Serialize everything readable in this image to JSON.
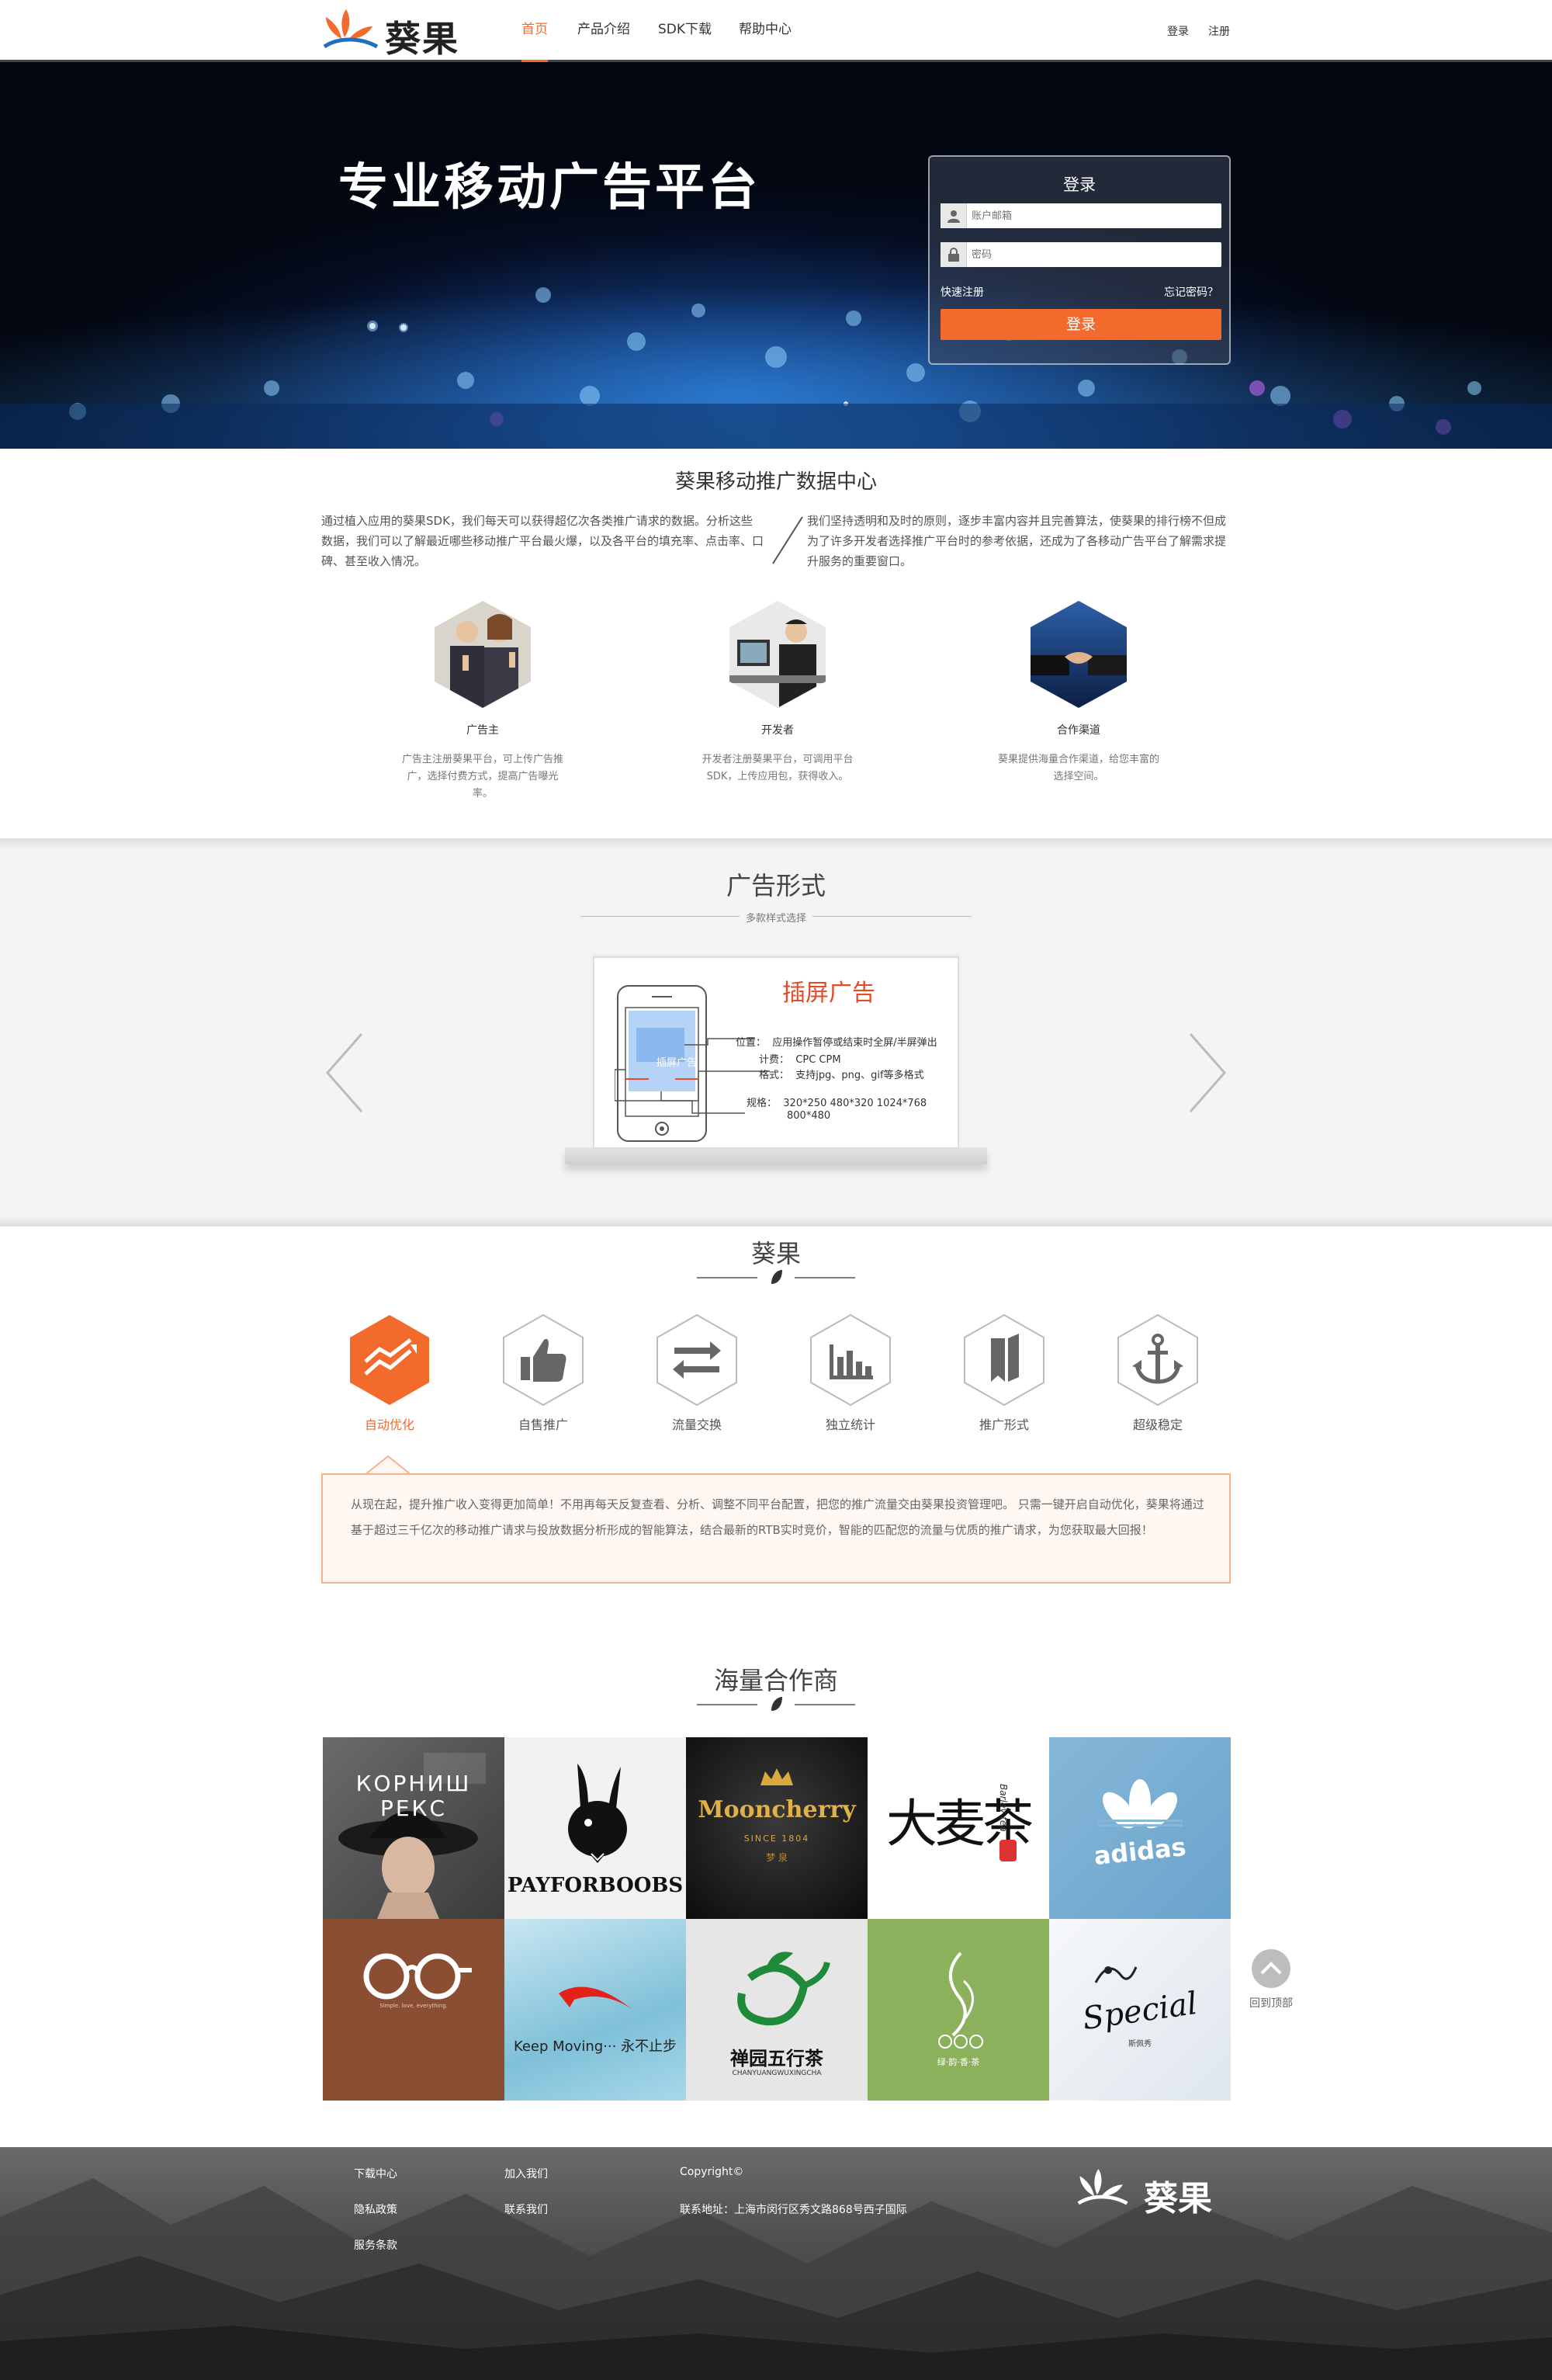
{
  "header": {
    "logo_text": "葵果",
    "nav": [
      "首页",
      "产品介绍",
      "SDK下载",
      "帮助中心"
    ],
    "login": "登录",
    "register": "注册"
  },
  "hero": {
    "title": "专业移动广告平台",
    "login_title": "登录",
    "email_placeholder": "账户邮箱",
    "password_placeholder": "密码",
    "quick_register": "快速注册",
    "forgot_password": "忘记密码？",
    "login_button": "登录"
  },
  "data_center": {
    "title": "葵果移动推广数据中心",
    "left_text": "通过植入应用的葵果SDK，我们每天可以获得超亿次各类推广请求的数据。分析这些数据，我们可以了解最近哪些移动推广平台最火爆，以及各平台的填充率、点击率、口碑、甚至收入情况。",
    "right_text": "我们坚持透明和及时的原则，逐步丰富内容并且完善算法，使葵果的排行榜不但成为了许多开发者选择推广平台时的参考依据，还成为了各移动广告平台了解需求提升服务的重要窗口。",
    "roles": [
      {
        "name": "广告主",
        "desc": "广告主注册葵果平台，可上传广告推广，选择付费方式，提高广告曝光率。"
      },
      {
        "name": "开发者",
        "desc": "开发者注册葵果平台，可调用平台SDK，上传应用包，获得收入。"
      },
      {
        "name": "合作渠道",
        "desc": "葵果提供海量合作渠道，给您丰富的选择空间。"
      }
    ]
  },
  "ad_format": {
    "title": "广告形式",
    "subtitle": "多款样式选择",
    "card_title": "插屏广告",
    "screen_label": "插屏广告",
    "position_label": "位置：",
    "position_value": "应用操作暂停或结束时全屏/半屏弹出",
    "billing_label": "计费：",
    "billing_value": "CPC  CPM",
    "format_label": "格式：",
    "format_value": "支持jpg、png、gif等多格式",
    "spec_label": "规格：",
    "spec_value": "320*250  480*320  1024*768",
    "spec_value2": "800*480"
  },
  "features": {
    "title": "葵果",
    "items": [
      "自动优化",
      "自售推广",
      "流量交换",
      "独立统计",
      "推广形式",
      "超级稳定"
    ],
    "text": "从现在起，提升推广收入变得更加简单！不用再每天反复查看、分析、调整不同平台配置，把您的推广流量交由葵果投资管理吧。 只需一键开启自动优化，葵果将通过基于超过三千亿次的移动推广请求与投放数据分析形成的智能算法，结合最新的RTB实时竞价，智能的匹配您的流量与优质的推广请求，为您获取最大回报！"
  },
  "partners": {
    "title": "海量合作商",
    "row1": [
      "КОРНИШ РЕКС",
      "PAYFORBOOBS",
      "Mooncherry",
      "大麦茶",
      "adidas"
    ],
    "moon_sub": "SINCE 1804",
    "moon_cn": "梦 泉",
    "bull_sub": "Barley tea",
    "row2": [
      "",
      "Keep Moving··· 永不止步",
      "禅园五行茶",
      "",
      "Special"
    ],
    "chanyuan_sub": "CHANYUANGWUXINGCHA",
    "special_sub": "斯佩秀",
    "leaf_sub": "绿·韵·香·茶",
    "glasses_sub": "Simple. love. everything."
  },
  "back_top": "回到顶部",
  "footer": {
    "col1": [
      "下载中心",
      "隐私政策",
      "服务条款"
    ],
    "col2": [
      "加入我们",
      "联系我们"
    ],
    "copyright": "Copyright©",
    "address": "联系地址：上海市闵行区秀文路868号西子国际",
    "logo_text": "葵果"
  },
  "colors": {
    "accent": "#f26b2d",
    "hero_bg": "#050d22",
    "footer_bg": "#4f4f4f"
  }
}
